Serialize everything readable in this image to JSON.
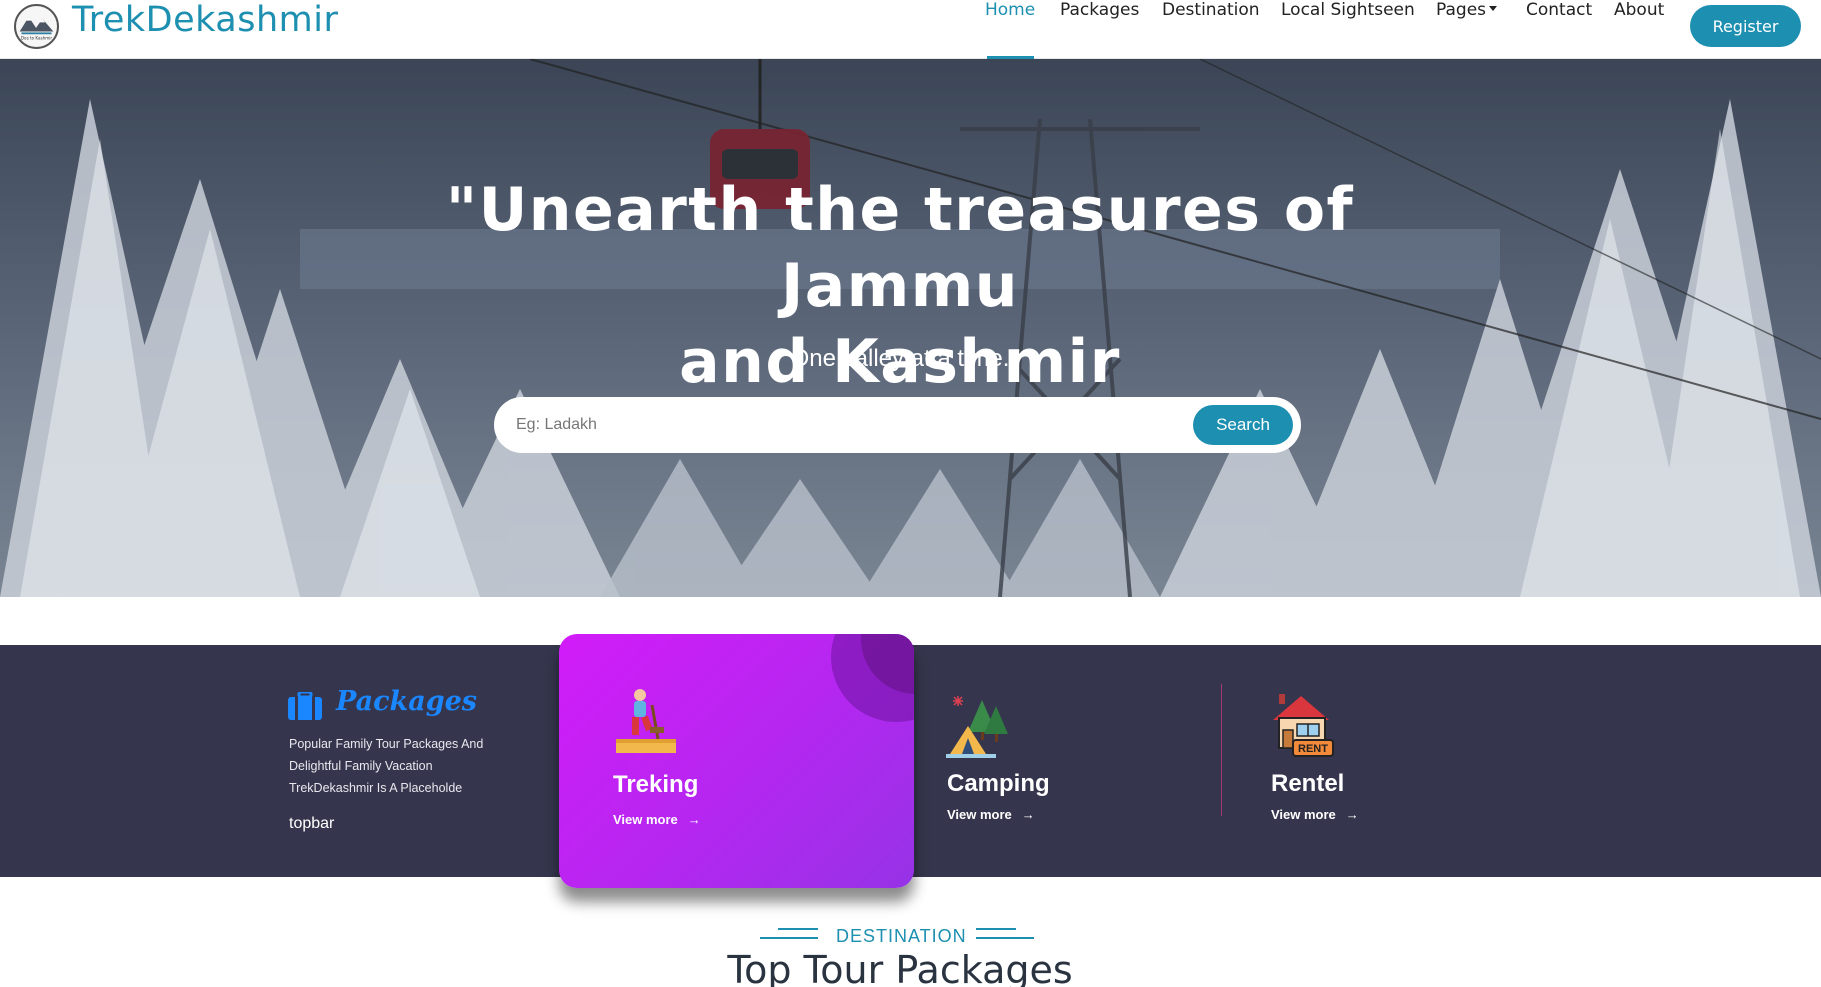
{
  "navbar": {
    "brand": "TrekDekashmir",
    "logo_text": "Dos to Kashmir",
    "links": [
      "Home",
      "Packages",
      "Destination",
      "Local Sightseen",
      "Pages",
      "Contact",
      "About"
    ],
    "active": "Home",
    "register_label": "Register"
  },
  "hero": {
    "title_line1": "\"Unearth the treasures of Jammu",
    "title_line2": "and Kashmir",
    "subtitle": "One valley at a time.",
    "search": {
      "placeholder": "Eg: Ladakh",
      "button_label": "Search"
    }
  },
  "features": {
    "packages": {
      "title": "Packages",
      "description": "Popular Family Tour Packages And Delightful Family Vacation TrekDekashmir Is A Placeholde",
      "footer": "topbar",
      "icon": "suitcase-icon",
      "color": "#1a86ff"
    },
    "cards": [
      {
        "title": "Treking",
        "link": "View more",
        "icon": "hiker-icon"
      },
      {
        "title": "Camping",
        "link": "View more",
        "icon": "tent-icon"
      },
      {
        "title": "Rentel",
        "link": "View more",
        "icon": "rent-house-icon"
      }
    ]
  },
  "destination": {
    "eyebrow": "DESTINATION",
    "heading": "Top Tour Packages"
  },
  "colors": {
    "primary": "#1d8fb0",
    "band": "#35354d",
    "card_gradient_start": "#d21cf8",
    "card_gradient_end": "#9633e6"
  }
}
